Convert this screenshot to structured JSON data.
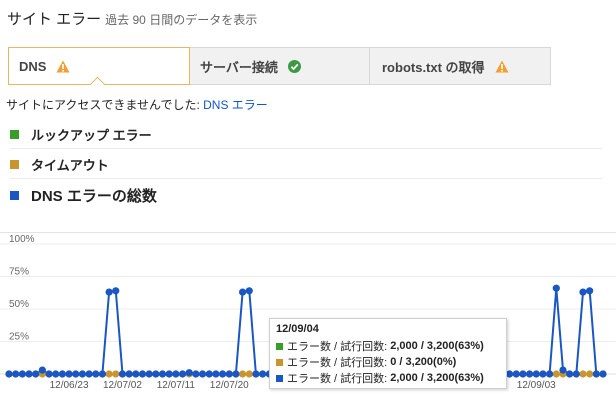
{
  "header": {
    "title": "サイト エラー",
    "subtitle": "過去 90 日間のデータを表示"
  },
  "tabs": [
    {
      "label": "DNS",
      "status": "warning",
      "active": true
    },
    {
      "label": "サーバー接続",
      "status": "ok",
      "active": false
    },
    {
      "label": "robots.txt の取得",
      "status": "warning",
      "active": false
    }
  ],
  "message": {
    "prefix": "サイトにアクセスできませんでした: ",
    "link": "DNS エラー"
  },
  "legend": [
    {
      "label": "ルックアップ エラー",
      "color": "#3a9c2a"
    },
    {
      "label": "タイムアウト",
      "color": "#c9952f"
    },
    {
      "label": "DNS エラーの総数",
      "color": "#1a56c4"
    }
  ],
  "colors": {
    "warning": "#f0a030",
    "ok": "#3c9b42",
    "link": "#1155cc"
  },
  "tooltip": {
    "date": "12/09/04",
    "rows": [
      {
        "label": "エラー数 / 試行回数:",
        "value": "2,000 / 3,200(63%)",
        "color": "#3a9c2a"
      },
      {
        "label": "エラー数 / 試行回数:",
        "value": "0 / 3,200(0%)",
        "color": "#c9952f"
      },
      {
        "label": "エラー数 / 試行回数:",
        "value": "2,000 / 3,200(63%)",
        "color": "#1a56c4"
      }
    ]
  },
  "chart_data": {
    "type": "line",
    "ylim": [
      0,
      100
    ],
    "yticks": [
      "100%",
      "75%",
      "50%",
      "25%"
    ],
    "x_tick_labels": [
      "12/06/23",
      "12/07/02",
      "12/07/11",
      "12/07/20",
      "12/09/03"
    ],
    "series": [
      {
        "name": "タイムアウト",
        "color": "#c9952f",
        "values": [
          0,
          0,
          0,
          0,
          0,
          0,
          0,
          0,
          0,
          0,
          0,
          0,
          0,
          0,
          0,
          0,
          0,
          0,
          0,
          0,
          0,
          0,
          0,
          0,
          0,
          0,
          0,
          0,
          0,
          0,
          0,
          0,
          0,
          0,
          0,
          0,
          0,
          0,
          0,
          0,
          0,
          0,
          0,
          0,
          0,
          0,
          0,
          0,
          0,
          0,
          0,
          0,
          0,
          0,
          0,
          0,
          0,
          0,
          0,
          0,
          0,
          0,
          0,
          0,
          0,
          0,
          0,
          0,
          0,
          0,
          0,
          0,
          0,
          0,
          0,
          0,
          0,
          0,
          0,
          0,
          0,
          0,
          0,
          0,
          0,
          0,
          0,
          0,
          0,
          0
        ]
      },
      {
        "name": "DNS エラーの総数",
        "color": "#1a56c4",
        "values": [
          0,
          0,
          0,
          0,
          0,
          3,
          0,
          0,
          0,
          0,
          0,
          0,
          0,
          0,
          0,
          63,
          64,
          0,
          0,
          0,
          0,
          0,
          0,
          0,
          0,
          0,
          0,
          1,
          0,
          0,
          0,
          0,
          0,
          0,
          0,
          63,
          64,
          0,
          0,
          0,
          0,
          0,
          0,
          0,
          0,
          0,
          0,
          0,
          0,
          0,
          0,
          0,
          0,
          0,
          0,
          0,
          0,
          0,
          0,
          0,
          0,
          0,
          0,
          0,
          0,
          0,
          0,
          0,
          0,
          0,
          0,
          0,
          0,
          0,
          0,
          0,
          0,
          0,
          0,
          0,
          0,
          0,
          66,
          3,
          0,
          0,
          63,
          64,
          0,
          0
        ]
      }
    ]
  }
}
